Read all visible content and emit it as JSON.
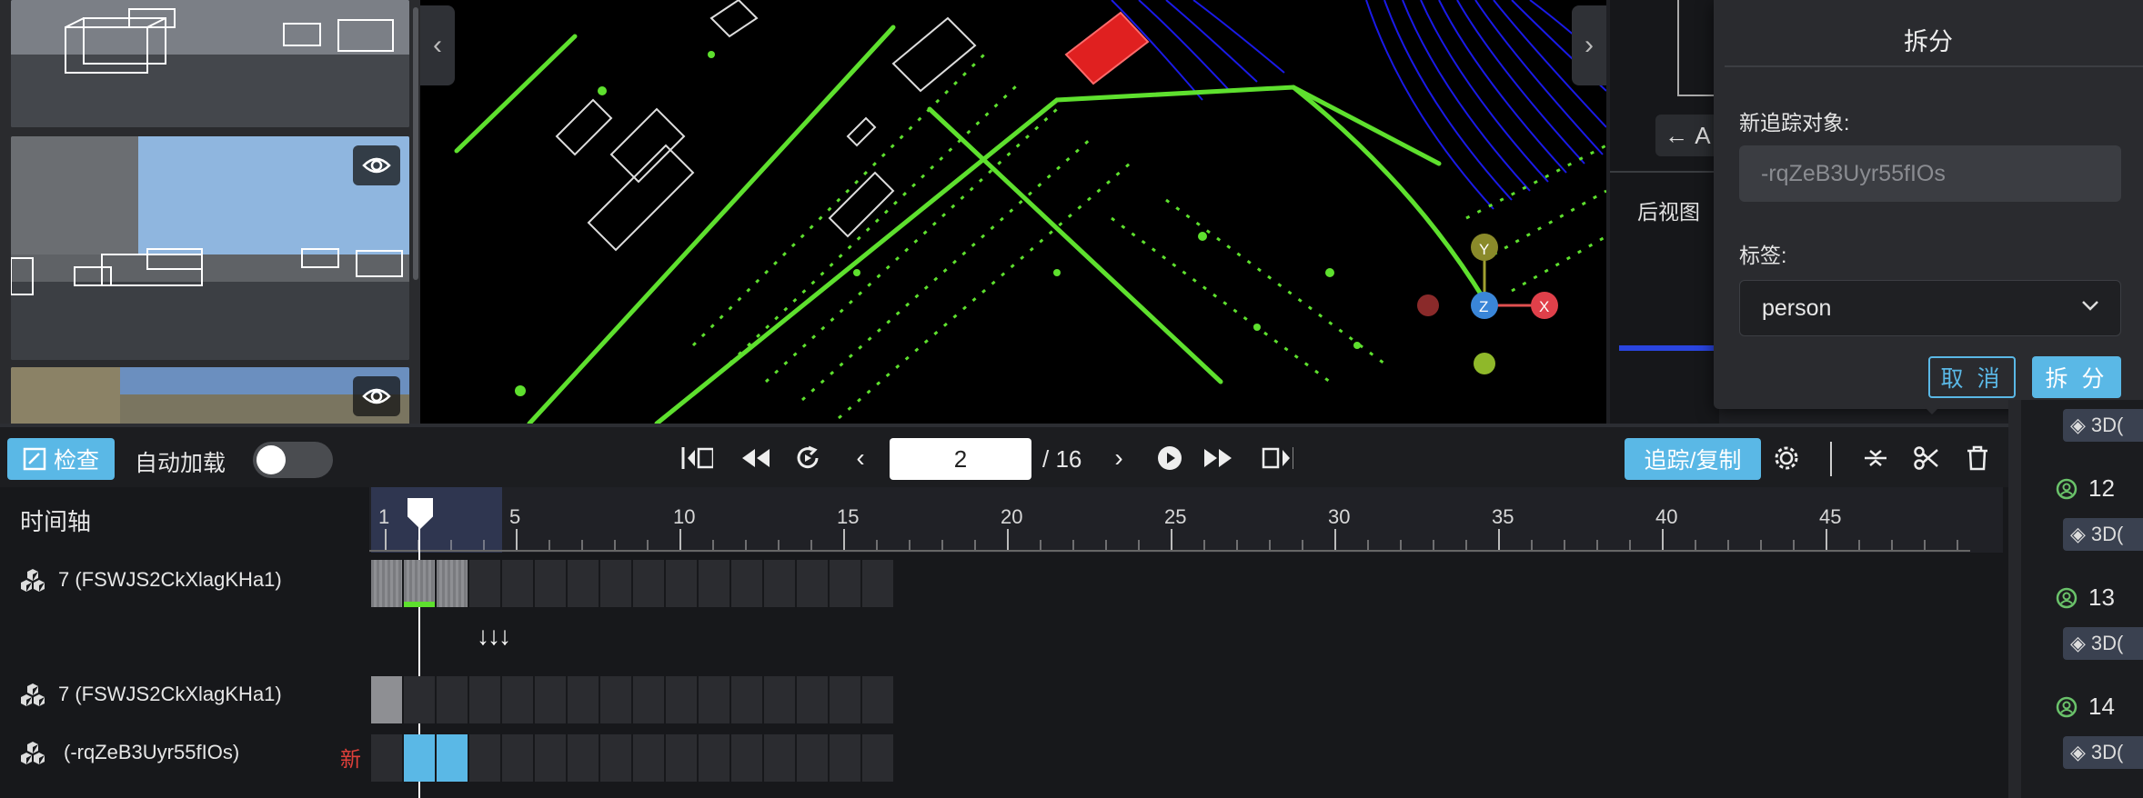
{
  "split_dialog": {
    "title": "拆分",
    "new_track_label": "新追踪对象:",
    "new_track_value": "-rqZeB3Uyr55fIOs",
    "tag_label": "标签:",
    "tag_value": "person",
    "cancel_label": "取 消",
    "confirm_label": "拆 分"
  },
  "side_view": {
    "label": "后视图",
    "back_label": "A"
  },
  "toolbar": {
    "inspect_label": "检查",
    "autoload_label": "自动加载",
    "autoload_on": false,
    "frame_value": "2",
    "frame_total": "/ 16",
    "track_copy_label": "追踪/复制"
  },
  "timeline": {
    "title": "时间轴",
    "ticks": [
      "1",
      "5",
      "10",
      "15",
      "20",
      "25",
      "30",
      "35",
      "40",
      "45"
    ],
    "current_frame": 2,
    "arrows": "↓↓↓",
    "rows": [
      {
        "label": "7 (FSWJS2CkXlagKHa1)",
        "badge": ""
      },
      {
        "label": "7 (FSWJS2CkXlagKHa1)",
        "badge": ""
      },
      {
        "label": "(-rqZeB3Uyr55fIOs)",
        "badge": "新"
      }
    ]
  },
  "object_list": {
    "items": [
      {
        "number": "",
        "tag": "3D("
      },
      {
        "number": "12",
        "tag": "3D("
      },
      {
        "number": "13",
        "tag": "3D("
      },
      {
        "number": "14",
        "tag": "3D("
      }
    ]
  },
  "colors": {
    "accent": "#5ab8e6",
    "new_badge": "#e0403a",
    "point_cloud_green": "#5ee02e",
    "ground_blue": "#1a1ae6"
  }
}
